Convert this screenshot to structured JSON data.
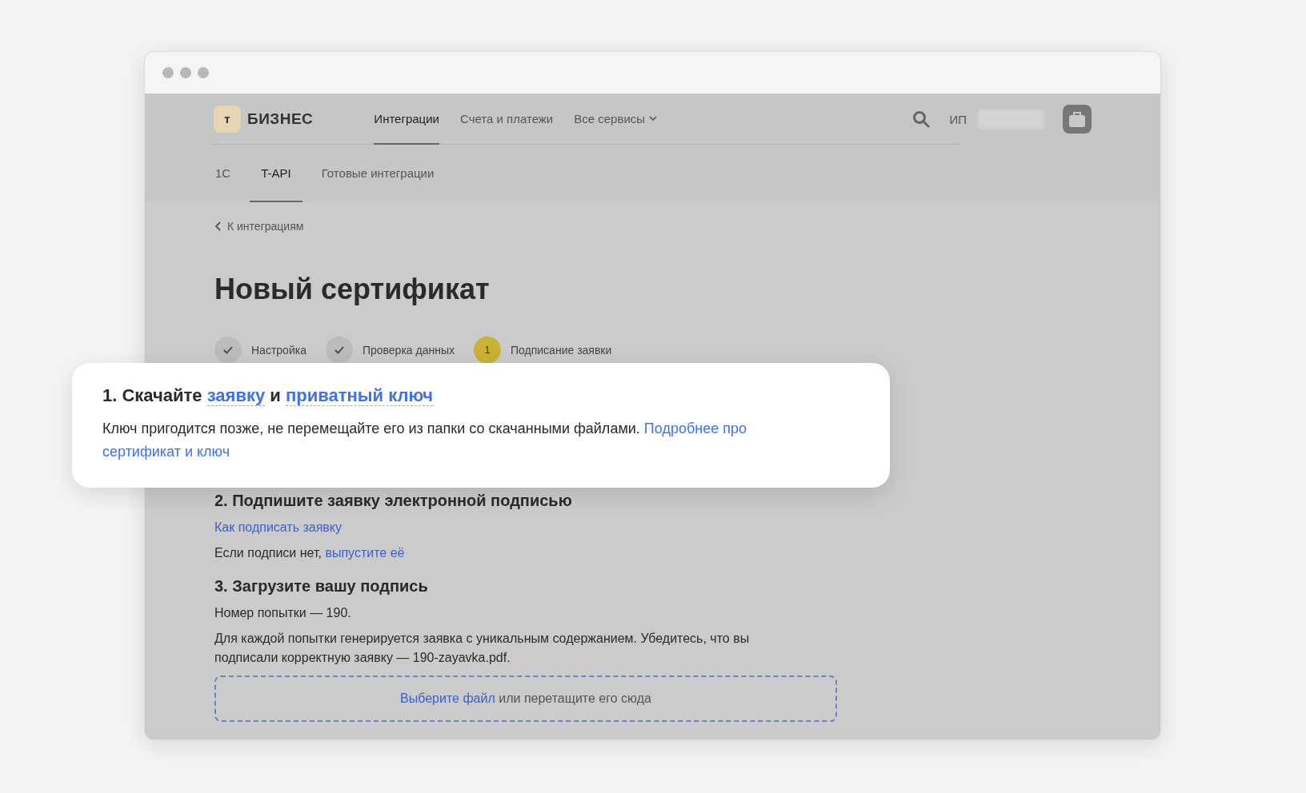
{
  "header": {
    "logo_letter": "т",
    "logo_text": "БИЗНЕС",
    "nav": [
      {
        "label": "Интеграции",
        "selected": true,
        "kind": "link"
      },
      {
        "label": "Счета и платежи",
        "selected": false,
        "kind": "link"
      },
      {
        "label": "Все сервисы",
        "selected": false,
        "kind": "dropdown"
      }
    ],
    "account_prefix": "ИП"
  },
  "subtabs": [
    {
      "label": "1С",
      "selected": false
    },
    {
      "label": "T-API",
      "selected": true
    },
    {
      "label": "Готовые интеграции",
      "selected": false
    }
  ],
  "back_link": "К интеграциям",
  "title": "Новый сертификат",
  "steps": [
    {
      "label": "Настройка",
      "completed": true
    },
    {
      "label": "Проверка данных",
      "completed": true
    },
    {
      "label": "Подписание заявки",
      "completed": false,
      "number": "1"
    }
  ],
  "callout": {
    "heading": [
      {
        "kind": "text",
        "text": "1. Скачайте "
      },
      {
        "kind": "link",
        "text": "заявку"
      },
      {
        "kind": "text",
        "text": " и "
      },
      {
        "kind": "link",
        "text": "приватный ключ"
      }
    ],
    "body": [
      {
        "kind": "text",
        "text": "Ключ пригодится позже, не перемещайте его из папки со скачанными файлами. "
      },
      {
        "kind": "link",
        "text": "Подробнее про"
      },
      {
        "kind": "link",
        "text": "сертификат и ключ"
      }
    ]
  },
  "sign_section": {
    "heading": "2. Подпишите заявку электронной подписью",
    "link": "Как подписать заявку",
    "note": [
      {
        "kind": "text",
        "text": "Если подписи нет, "
      },
      {
        "kind": "link",
        "text": "выпустите её"
      }
    ]
  },
  "upload_section": {
    "heading": "3. Загрузите вашу подпись",
    "attempt": "Номер попытки — 190.",
    "paragraph": "Для каждой попытки генерируется заявка с уникальным содержанием. Убедитесь, что вы подписали корректную заявку — 190-zayavka.pdf.",
    "dropzone": {
      "link": "Выберите файл",
      "text": "или перетащите его сюда"
    }
  }
}
